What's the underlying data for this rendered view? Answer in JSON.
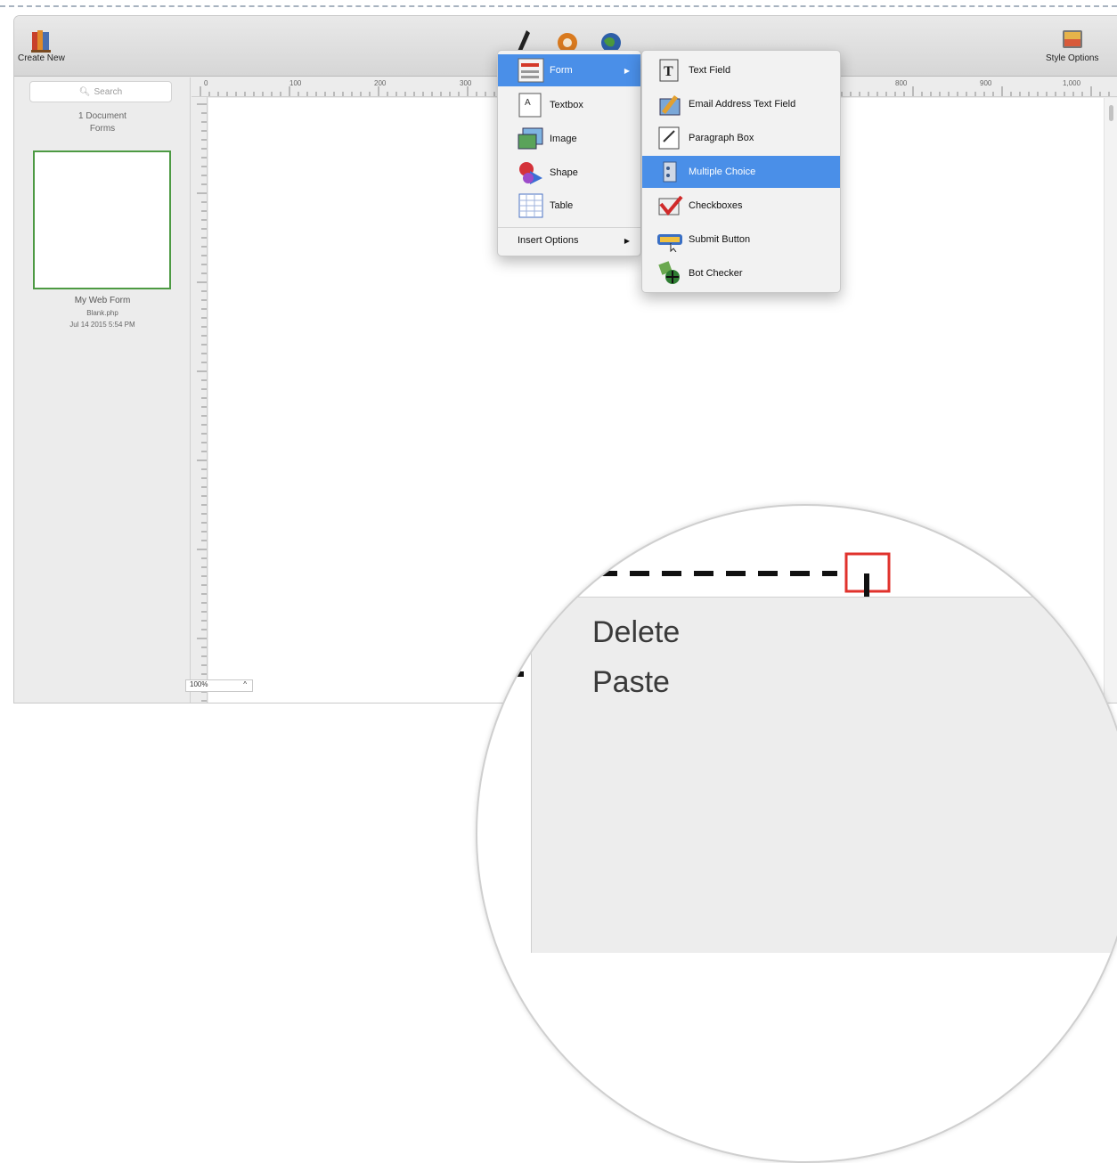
{
  "toolbar": {
    "create_new_label": "Create New",
    "style_options_label": "Style Options"
  },
  "sidebar": {
    "search_placeholder": "Search",
    "doc_count": "1 Document",
    "doc_category": "Forms",
    "document": {
      "name": "My Web Form",
      "file": "Blank.php",
      "date": "Jul 14 2015 5:54 PM"
    }
  },
  "ruler": {
    "top_ticks": [
      "0",
      "100",
      "200",
      "300",
      "800",
      "900",
      "1,000"
    ],
    "left_ticks": [
      "100",
      "200",
      "300",
      "400",
      "500",
      "600"
    ]
  },
  "zoom": "100%",
  "insert_menu": {
    "items": [
      {
        "label": "Form",
        "icon": "form-icon",
        "selected": true,
        "submenu": true
      },
      {
        "label": "Textbox",
        "icon": "textbox-icon"
      },
      {
        "label": "Image",
        "icon": "image-icon"
      },
      {
        "label": "Shape",
        "icon": "shape-icon"
      },
      {
        "label": "Table",
        "icon": "table-icon"
      }
    ],
    "options_label": "Insert Options"
  },
  "form_submenu": {
    "items": [
      {
        "label": "Text Field",
        "icon": "text-field-icon"
      },
      {
        "label": "Email Address Text Field",
        "icon": "email-field-icon"
      },
      {
        "label": "Paragraph Box",
        "icon": "paragraph-box-icon"
      },
      {
        "label": "Multiple Choice",
        "icon": "multiple-choice-icon",
        "selected": true
      },
      {
        "label": "Checkboxes",
        "icon": "checkboxes-icon"
      },
      {
        "label": "Submit Button",
        "icon": "submit-button-icon"
      },
      {
        "label": "Bot Checker",
        "icon": "bot-checker-icon"
      }
    ]
  },
  "magnified_menu": {
    "items": [
      "Delete",
      "Paste"
    ]
  },
  "colors": {
    "selection": "#4a8fe8",
    "thumb_border": "#4d9a43",
    "accent_red": "#e0322c"
  }
}
